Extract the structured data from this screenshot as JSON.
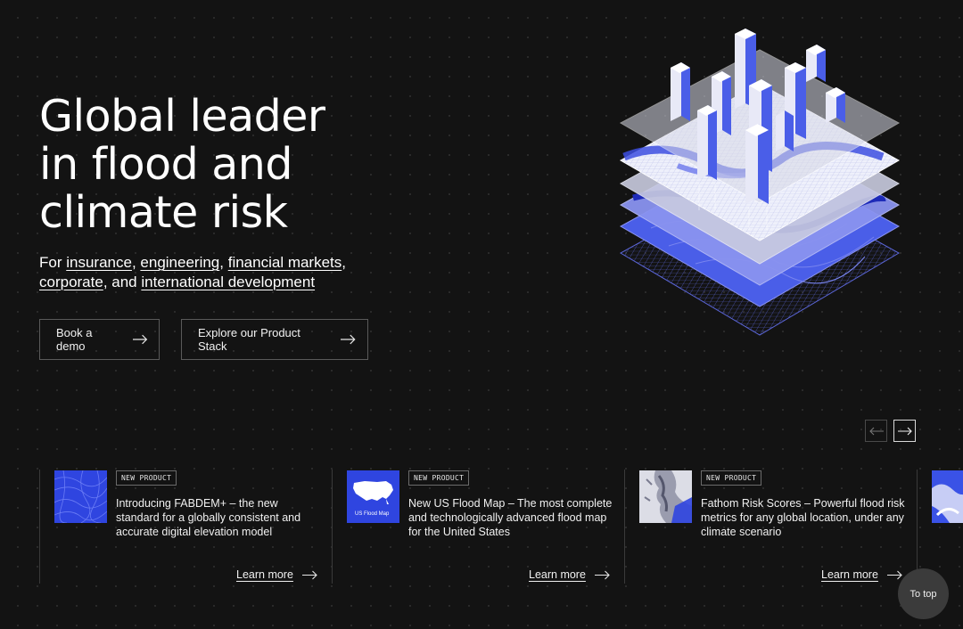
{
  "hero": {
    "title_lines": [
      "Global leader",
      "in flood and",
      "climate risk"
    ],
    "subtitle": {
      "prefix": "For ",
      "links": [
        "insurance",
        "engineering",
        "financial markets",
        "corporate",
        "international development"
      ],
      "separators": [
        ", ",
        ", ",
        ",",
        ", and "
      ]
    },
    "buttons": {
      "demo": "Book a demo",
      "stack": "Explore our Product Stack"
    }
  },
  "carousel": {
    "cards": [
      {
        "badge": "NEW PRODUCT",
        "description": "Introducing FABDEM+ – the new standard for a globally consistent and accurate digital elevation model",
        "link": "Learn more",
        "thumb": "elevation-map-thumbnail"
      },
      {
        "badge": "NEW PRODUCT",
        "description": "New US Flood Map – The most complete and technologically advanced flood map for the United States",
        "link": "Learn more",
        "thumb_label": "US Flood Map"
      },
      {
        "badge": "NEW PRODUCT",
        "description": "Fathom Risk Scores – Powerful flood risk metrics for any global location, under any climate scenario",
        "link": "Learn more",
        "thumb": "risk-map-thumbnail"
      }
    ]
  },
  "to_top": "To top",
  "colors": {
    "accent": "#4a5ee8",
    "background": "#131313",
    "text": "#ffffff"
  },
  "icons": {
    "button": "arrow-right-icon",
    "prev": "arrow-left-icon",
    "next": "arrow-right-icon"
  }
}
